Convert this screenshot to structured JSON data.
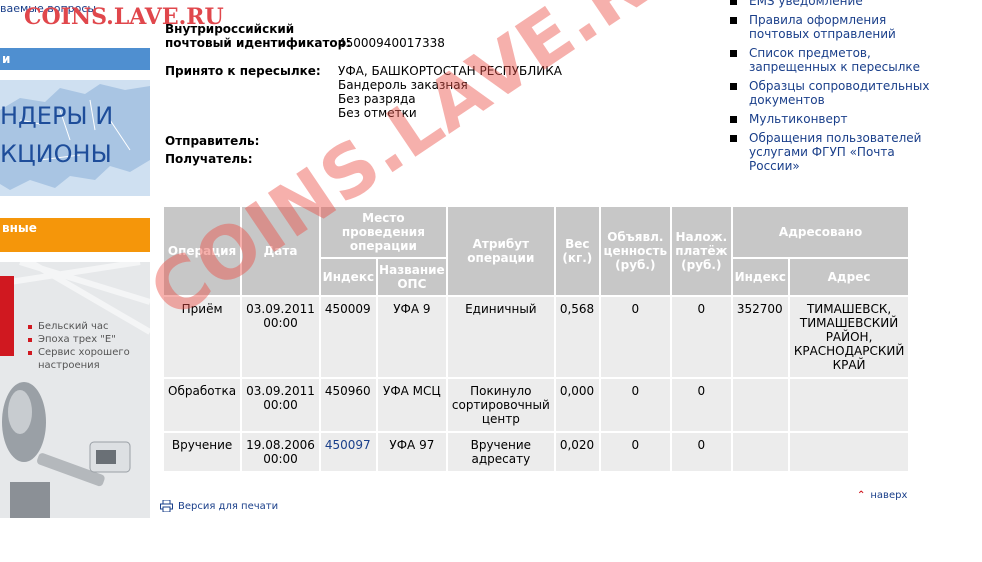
{
  "left": {
    "faq_link": "ваемые вопросы",
    "blue_bar": "и",
    "banner_line1": "НДЕРЫ И",
    "banner_line2": "КЦИОНЫ",
    "orange_bar": "вные",
    "promo_items": [
      "Бельский час",
      "Эпоха трех \"Е\"",
      "Сервис хорошего",
      "настроения"
    ]
  },
  "watermark_top": "COINS.LAVE.RU",
  "watermark_diag": "COINS.LAVE.RU",
  "info": {
    "id_label_1": "Внутрироссийский",
    "id_label_2": "почтовый идентификатор:",
    "id_value": "45000940017338",
    "accepted_label": "Принято к пересылке:",
    "accepted_lines": [
      "УФА, БАШКОРТОСТАН РЕСПУБЛИКА",
      "Бандероль заказная",
      "Без разряда",
      "Без отметки"
    ],
    "sender_label": "Отправитель:",
    "recipient_label": "Получатель:"
  },
  "right_menu": [
    "EMS уведомление",
    "Правила оформления почтовых отправлений",
    "Список предметов, запрещенных к пересылке",
    "Образцы сопроводительных документов",
    "Мультиконверт",
    "Обращения пользователей услугами ФГУП «Почта России»"
  ],
  "table": {
    "headers": {
      "operation": "Операция",
      "date": "Дата",
      "place": "Место проведения операции",
      "index": "Индекс",
      "ops_name": "Название ОПС",
      "attribute": "Атрибут операции",
      "weight": "Вес (кг.)",
      "declared": "Объявл. ценность (руб.)",
      "cod": "Налож. платёж (руб.)",
      "addressed": "Адресовано",
      "addr_index": "Индекс",
      "address": "Адрес"
    },
    "rows": [
      {
        "operation": "Приём",
        "date": "03.09.2011 00:00",
        "index": "450009",
        "ops": "УФА 9",
        "attribute": "Единичный",
        "weight": "0,568",
        "declared": "0",
        "cod": "0",
        "addr_index": "352700",
        "address": "ТИМАШЕВСК, ТИМАШЕВСКИЙ РАЙОН, КРАСНОДАРСКИЙ КРАЙ"
      },
      {
        "operation": "Обработка",
        "date": "03.09.2011 00:00",
        "index": "450960",
        "ops": "УФА МСЦ",
        "attribute": "Покинуло сортировочный центр",
        "weight": "0,000",
        "declared": "0",
        "cod": "0",
        "addr_index": "",
        "address": ""
      },
      {
        "operation": "Вручение",
        "date": "19.08.2006 00:00",
        "index": "450097",
        "ops": "УФА 97",
        "attribute": "Вручение адресату",
        "weight": "0,020",
        "declared": "0",
        "cod": "0",
        "addr_index": "",
        "address": ""
      }
    ]
  },
  "footer": {
    "print_label": "Версия для печати",
    "up_label": "наверх"
  }
}
